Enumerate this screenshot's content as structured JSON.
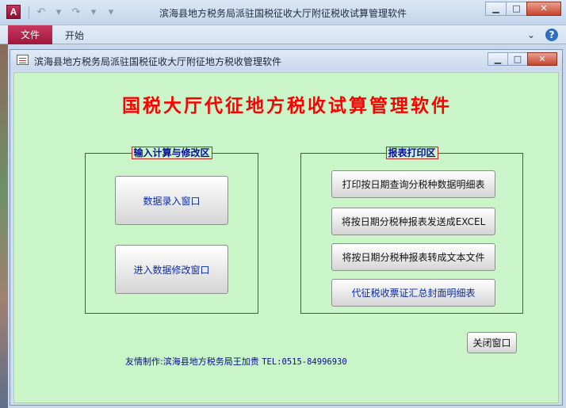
{
  "app": {
    "window_title": "滨海县地方税务局派驻国税征收大厅附征税收试算管理软件",
    "icon_letter": "A"
  },
  "ribbon": {
    "file_tab": "文件",
    "home_tab": "开始"
  },
  "form": {
    "window_title": "滨海县地方税务局派驻国税征收大厅附征地方税收管理软件",
    "main_title": "国税大厅代征地方税收试算管理软件",
    "input_group": {
      "label": "输入计算与修改区",
      "buttons": [
        "数据录入窗口",
        "进入数据修改窗口"
      ]
    },
    "report_group": {
      "label": "报表打印区",
      "buttons": [
        "打印按日期查询分税种数据明细表",
        "将按日期分税种报表发送成EXCEL",
        "将按日期分税种报表转成文本文件",
        "代征税收票证汇总封面明细表"
      ]
    },
    "credit": "友情制作:滨海县地方税务局王加贵",
    "tel": "TEL:0515-84996930",
    "close_button": "关闭窗口"
  },
  "colors": {
    "form_background": "#c9f5c9",
    "title_red": "#ff0000",
    "group_border": "#c02020",
    "label_blue": "#0a0aa0",
    "file_tab": "#b0224a"
  }
}
